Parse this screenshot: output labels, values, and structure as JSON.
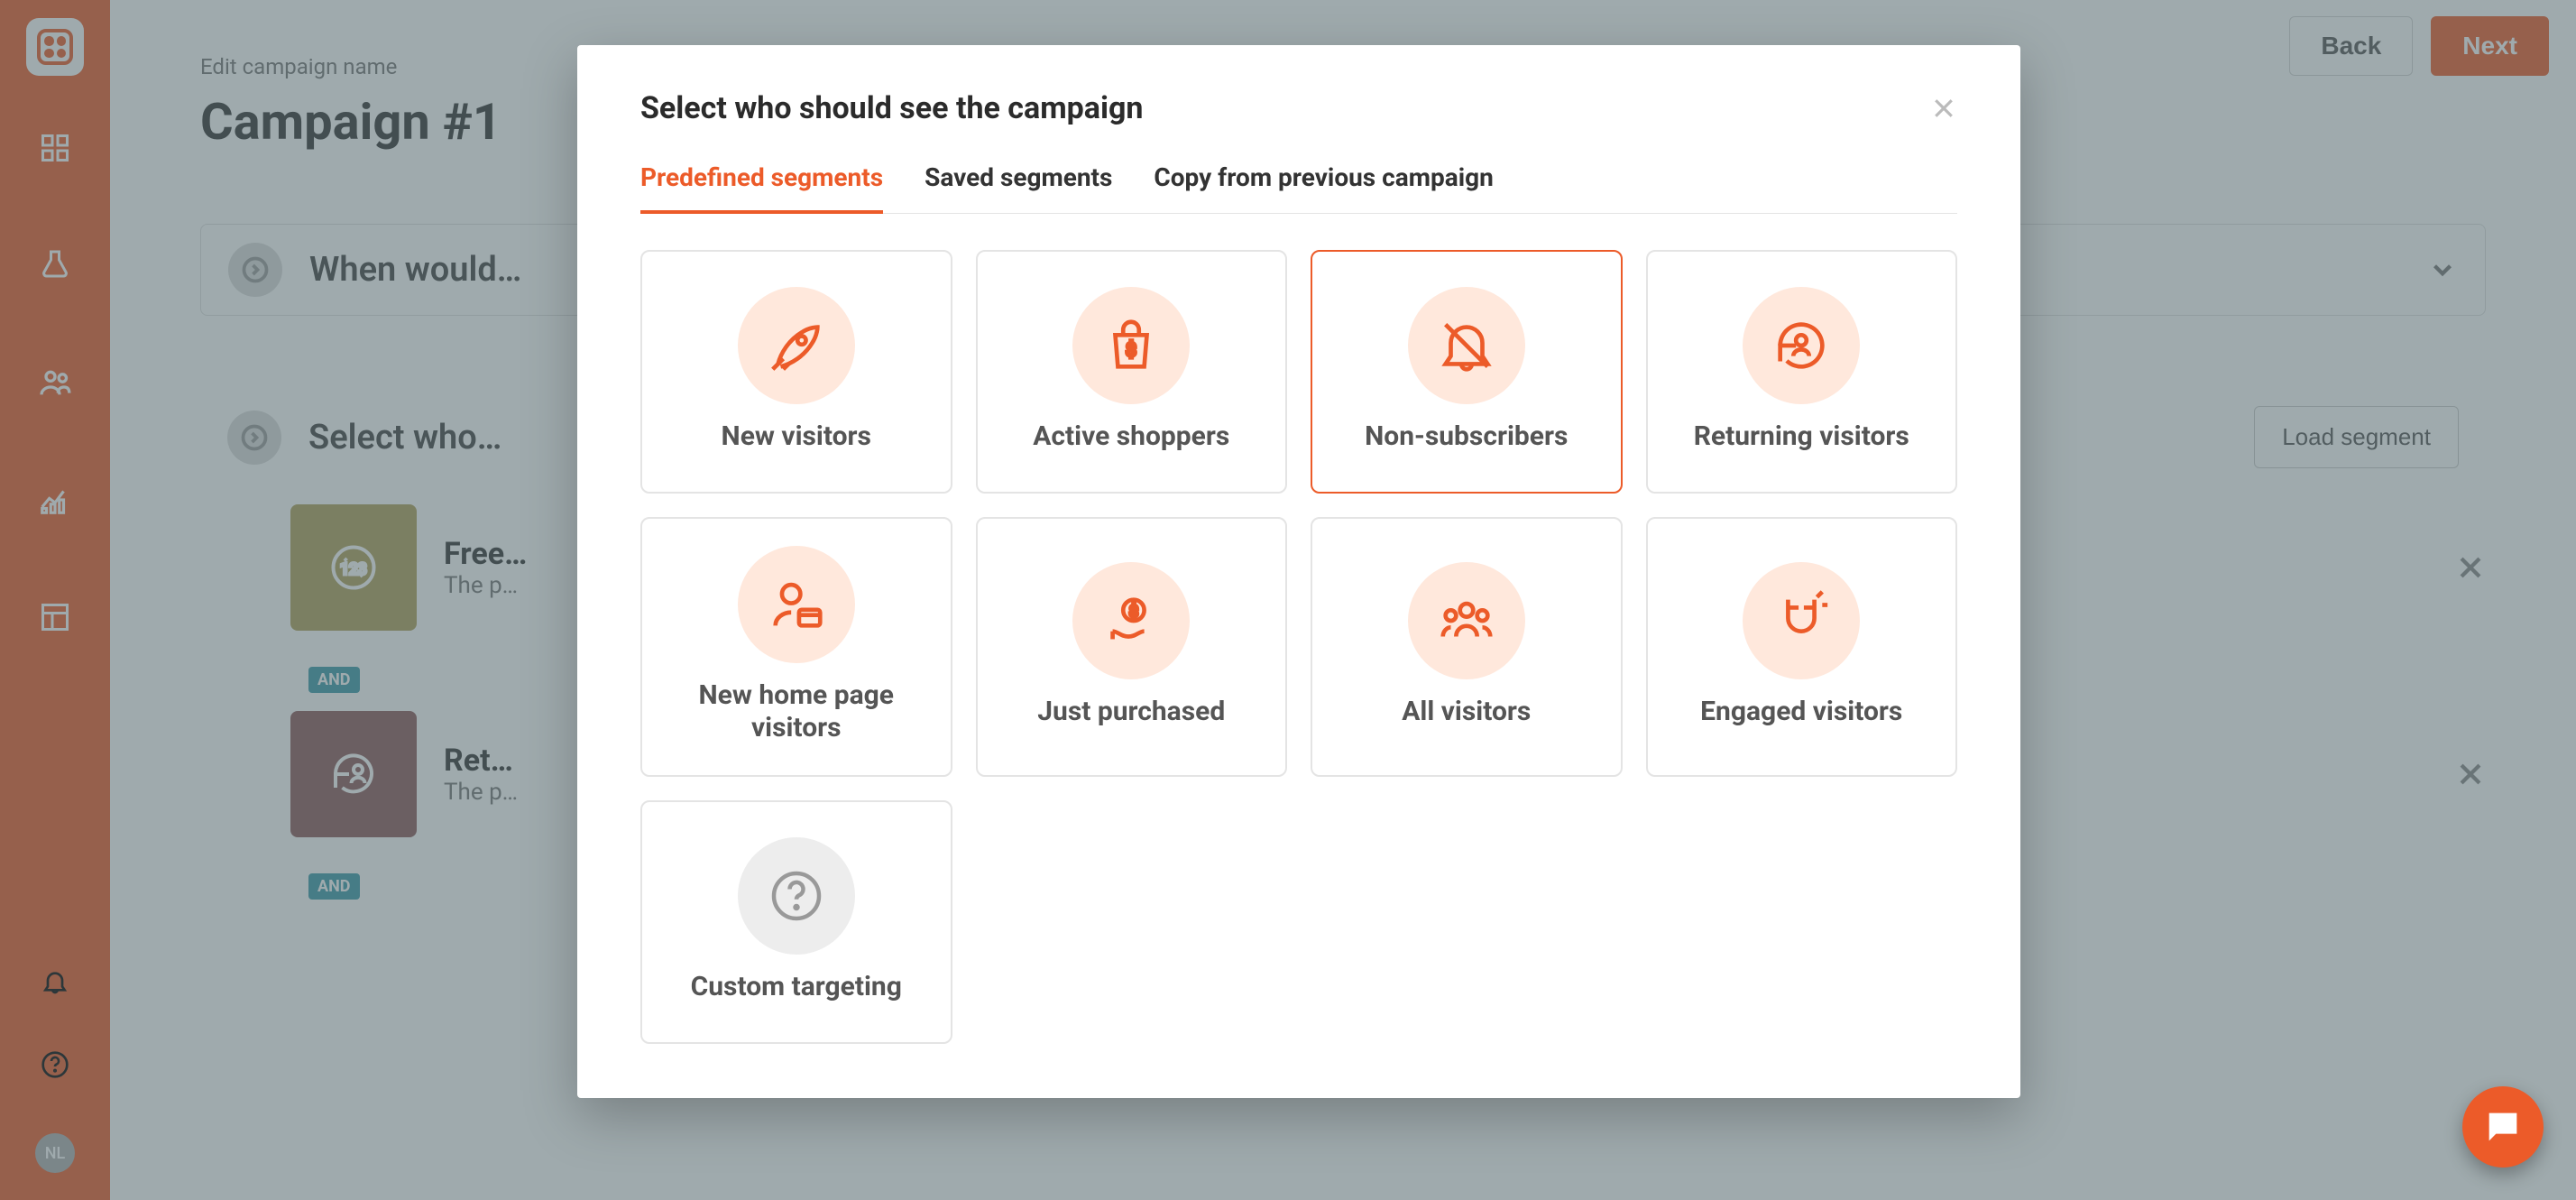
{
  "sidebar": {
    "avatar_initials": "NL"
  },
  "header": {
    "back_label": "Back",
    "next_label": "Next"
  },
  "page": {
    "edit_name_label": "Edit campaign name",
    "title": "Campaign #1"
  },
  "sections": {
    "when": {
      "title": "When would…"
    },
    "who": {
      "title": "Select who…",
      "load_segment_label": "Load segment"
    }
  },
  "rules": {
    "and_label": "AND",
    "items": [
      {
        "title": "Free…",
        "subtitle": "The p…"
      },
      {
        "title": "Ret…",
        "subtitle": "The p…"
      }
    ]
  },
  "modal": {
    "title": "Select who should see the campaign",
    "tabs": {
      "predefined": "Predefined segments",
      "saved": "Saved segments",
      "copy": "Copy from previous campaign"
    },
    "active_tab": "predefined",
    "selected_card": "non_subscribers",
    "cards": {
      "new_visitors": "New visitors",
      "active_shoppers": "Active shoppers",
      "non_subscribers": "Non-subscribers",
      "returning_visitors": "Returning visitors",
      "new_home_page_visitors": "New home page visitors",
      "just_purchased": "Just purchased",
      "all_visitors": "All visitors",
      "engaged_visitors": "Engaged visitors",
      "custom_targeting": "Custom targeting"
    }
  }
}
